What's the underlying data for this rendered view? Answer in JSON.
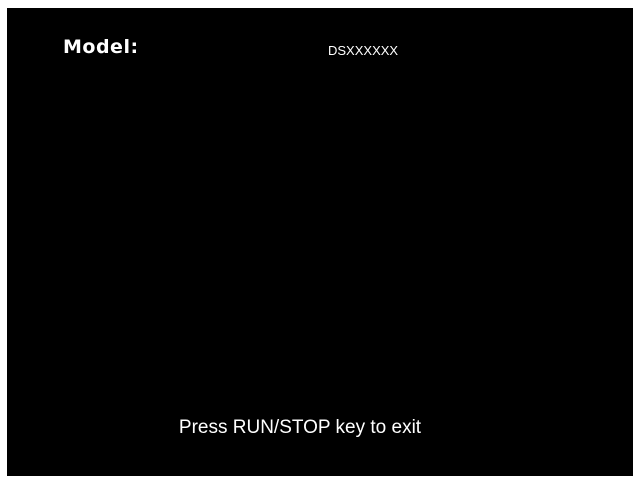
{
  "screen": {
    "model_label": "Model:",
    "model_value": "DSXXXXXX",
    "exit_hint": "Press RUN/STOP key to exit"
  },
  "colors": {
    "background": "#000000",
    "text": "#ffffff",
    "frame": "#ffffff"
  }
}
